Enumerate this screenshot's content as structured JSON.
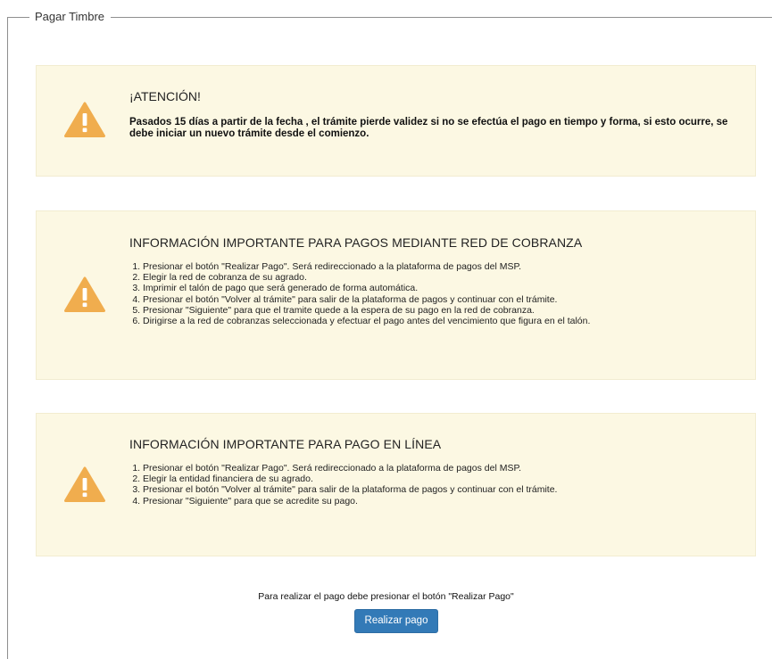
{
  "fieldset": {
    "legend": "Pagar Timbre"
  },
  "attention": {
    "icon": "warning-icon",
    "title": "¡ATENCIÓN!",
    "message": "Pasados 15 días a partir de la fecha , el trámite pierde validez si no se efectúa el pago en tiempo y forma, si esto ocurre, se debe iniciar un nuevo trámite desde el comienzo."
  },
  "red_cobranza": {
    "icon": "warning-icon",
    "title": "INFORMACIÓN IMPORTANTE PARA PAGOS MEDIANTE RED DE COBRANZA",
    "steps": [
      "Presionar el botón \"Realizar Pago\". Será redireccionado a la plataforma de pagos del MSP.",
      "Elegir la red de cobranza de su agrado.",
      "Imprimir el talón de pago que será generado de forma automática.",
      "Presionar el botón \"Volver al trámite\" para salir de la plataforma de pagos y continuar con el trámite.",
      "Presionar \"Siguiente\" para que el tramite quede a la espera de su pago en la red de cobranza.",
      "Dirigirse a la red de cobranzas seleccionada y efectuar el pago antes del vencimiento que figura en el talón."
    ]
  },
  "pago_linea": {
    "icon": "warning-icon",
    "title": "INFORMACIÓN IMPORTANTE PARA PAGO EN LÍNEA",
    "steps": [
      "Presionar el botón \"Realizar Pago\". Será redireccionado a la plataforma de pagos del MSP.",
      "Elegir la entidad financiera de su agrado.",
      "Presionar el botón \"Volver al trámite\" para salir de la plataforma de pagos y continuar con el trámite.",
      "Presionar \"Siguiente\" para que se acredite su pago."
    ]
  },
  "footer": {
    "instruction": "Para realizar el pago debe presionar el botón \"Realizar Pago\"",
    "pay_button": "Realizar pago"
  },
  "colors": {
    "alert_bg": "#fcf8e3",
    "warning_icon": "#f0ad4e",
    "primary_button": "#337ab7"
  }
}
